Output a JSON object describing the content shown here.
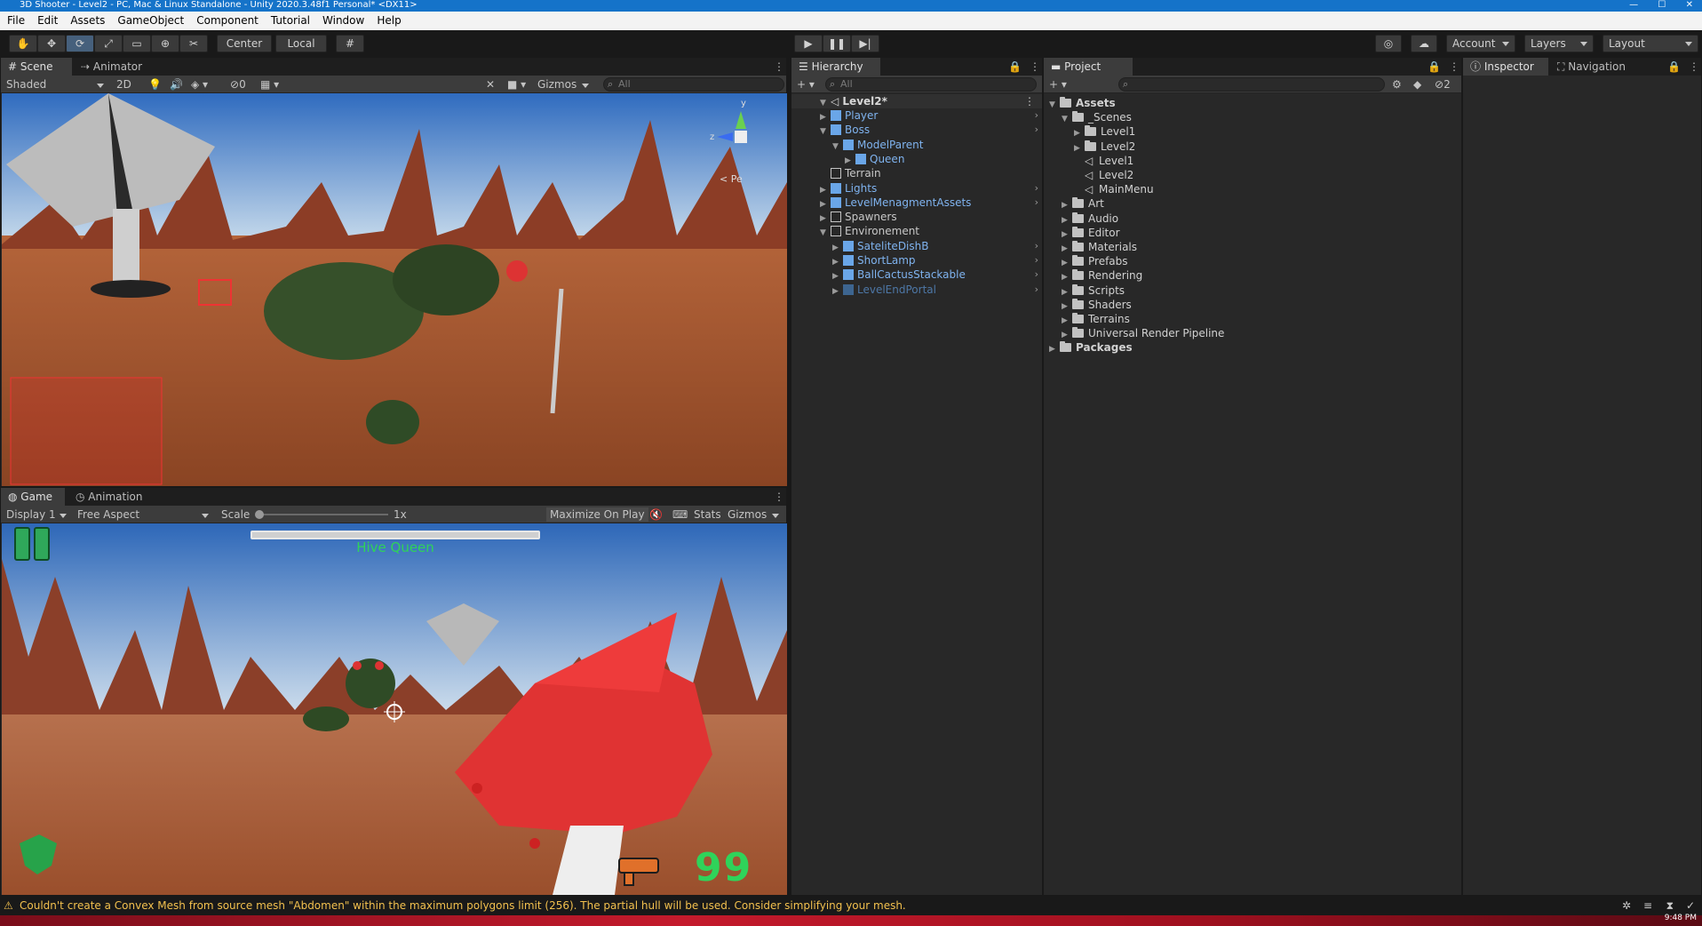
{
  "window": {
    "title": "3D Shooter - Level2 - PC, Mac & Linux Standalone - Unity 2020.3.48f1 Personal* <DX11>"
  },
  "menu": [
    "File",
    "Edit",
    "Assets",
    "GameObject",
    "Component",
    "Tutorial",
    "Window",
    "Help"
  ],
  "toolbar": {
    "pivot": "Center",
    "space": "Local",
    "account": "Account",
    "layers": "Layers",
    "layout": "Layout"
  },
  "scene": {
    "tabs": [
      "Scene",
      "Animator"
    ],
    "shading": "Shaded",
    "mode2d": "2D",
    "hidden_count": "0",
    "gizmos": "Gizmos",
    "search_placeholder": "All",
    "gizmo_axis_y": "y",
    "gizmo_axis_z": "z",
    "gizmo_persp": "< Pe"
  },
  "game": {
    "tabs": [
      "Game",
      "Animation"
    ],
    "display": "Display 1",
    "aspect": "Free Aspect",
    "scale_label": "Scale",
    "scale_value": "1x",
    "maximize": "Maximize On Play",
    "stats": "Stats",
    "gizmos": "Gizmos",
    "boss_name": "Hive Queen",
    "boss_health_fraction": 1.0,
    "ammo": "99"
  },
  "hierarchy": {
    "tab": "Hierarchy",
    "search_placeholder": "All",
    "scene_name": "Level2*",
    "items": [
      {
        "label": "Player",
        "depth": 1,
        "style": "blue",
        "expand": "closed",
        "chevron": true
      },
      {
        "label": "Boss",
        "depth": 1,
        "style": "blue",
        "expand": "open",
        "chevron": true
      },
      {
        "label": "ModelParent",
        "depth": 2,
        "style": "blue",
        "expand": "open",
        "chevron": false
      },
      {
        "label": "Queen",
        "depth": 3,
        "style": "blue",
        "expand": "closed",
        "chevron": false
      },
      {
        "label": "Terrain",
        "depth": 1,
        "style": "grey",
        "expand": "none",
        "chevron": false
      },
      {
        "label": "Lights",
        "depth": 1,
        "style": "blue",
        "expand": "closed",
        "chevron": true
      },
      {
        "label": "LevelMenagmentAssets",
        "depth": 1,
        "style": "blue",
        "expand": "closed",
        "chevron": true
      },
      {
        "label": "Spawners",
        "depth": 1,
        "style": "grey",
        "expand": "closed",
        "chevron": false
      },
      {
        "label": "Environement",
        "depth": 1,
        "style": "grey",
        "expand": "open",
        "chevron": false
      },
      {
        "label": "SateliteDishB",
        "depth": 2,
        "style": "blue",
        "expand": "closed",
        "chevron": true
      },
      {
        "label": "ShortLamp",
        "depth": 2,
        "style": "blue",
        "expand": "closed",
        "chevron": true
      },
      {
        "label": "BallCactusStackable",
        "depth": 2,
        "style": "blue",
        "expand": "closed",
        "chevron": true
      },
      {
        "label": "LevelEndPortal",
        "depth": 2,
        "style": "fade",
        "expand": "closed",
        "chevron": true
      }
    ]
  },
  "project": {
    "tab": "Project",
    "hidden_count": "2",
    "items": [
      {
        "label": "Assets",
        "depth": 0,
        "expand": "open",
        "kind": "folder",
        "bold": true
      },
      {
        "label": "_Scenes",
        "depth": 1,
        "expand": "open",
        "kind": "folder"
      },
      {
        "label": "Level1",
        "depth": 2,
        "expand": "closed",
        "kind": "folder"
      },
      {
        "label": "Level2",
        "depth": 2,
        "expand": "closed",
        "kind": "folder"
      },
      {
        "label": "Level1",
        "depth": 2,
        "expand": "none",
        "kind": "scene"
      },
      {
        "label": "Level2",
        "depth": 2,
        "expand": "none",
        "kind": "scene"
      },
      {
        "label": "MainMenu",
        "depth": 2,
        "expand": "none",
        "kind": "scene"
      },
      {
        "label": "Art",
        "depth": 1,
        "expand": "closed",
        "kind": "folder"
      },
      {
        "label": "Audio",
        "depth": 1,
        "expand": "closed",
        "kind": "folder"
      },
      {
        "label": "Editor",
        "depth": 1,
        "expand": "closed",
        "kind": "folder"
      },
      {
        "label": "Materials",
        "depth": 1,
        "expand": "closed",
        "kind": "folder"
      },
      {
        "label": "Prefabs",
        "depth": 1,
        "expand": "closed",
        "kind": "folder"
      },
      {
        "label": "Rendering",
        "depth": 1,
        "expand": "closed",
        "kind": "folder"
      },
      {
        "label": "Scripts",
        "depth": 1,
        "expand": "closed",
        "kind": "folder"
      },
      {
        "label": "Shaders",
        "depth": 1,
        "expand": "closed",
        "kind": "folder"
      },
      {
        "label": "Terrains",
        "depth": 1,
        "expand": "closed",
        "kind": "folder"
      },
      {
        "label": "Universal Render Pipeline",
        "depth": 1,
        "expand": "closed",
        "kind": "folder"
      },
      {
        "label": "Packages",
        "depth": 0,
        "expand": "closed",
        "kind": "folder",
        "bold": true
      }
    ]
  },
  "inspector": {
    "tabs": [
      "Inspector",
      "Navigation"
    ]
  },
  "status": {
    "message": "Couldn't create a Convex Mesh from source mesh \"Abdomen\" within the maximum polygons limit (256). The partial hull will be used. Consider simplifying your mesh."
  },
  "clock": "9:48 PM",
  "colors": {
    "accent_blue": "#1573c9",
    "prefab_blue": "#7fb3ef",
    "warning": "#f2c04e",
    "hud_green": "#2fd35a"
  }
}
